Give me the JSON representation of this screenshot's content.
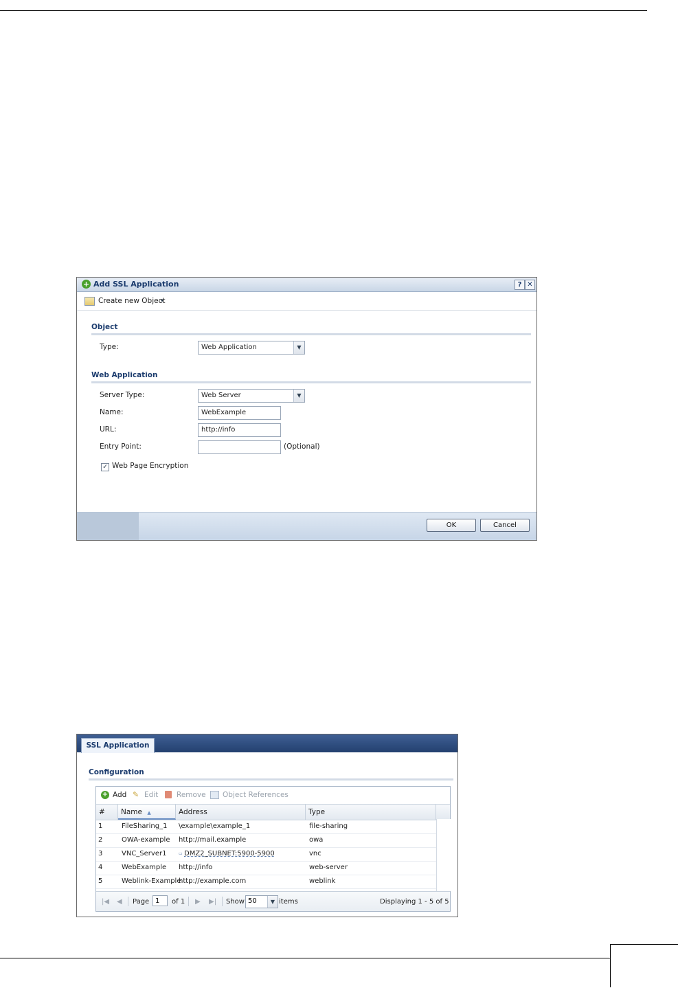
{
  "dialog": {
    "title": "Add SSL Application",
    "help_icon": "?",
    "close_icon": "✕",
    "toolbar": {
      "create_label": "Create new Object",
      "caret": "▾",
      "icon": "object-icon"
    },
    "section_object": "Object",
    "type_label": "Type:",
    "type_value": "Web Application",
    "section_webapp": "Web Application",
    "server_type_label": "Server Type:",
    "server_type_value": "Web Server",
    "name_label": "Name:",
    "name_value": "WebExample",
    "url_label": "URL:",
    "url_value": "http://info",
    "entry_point_label": "Entry Point:",
    "entry_point_value": "",
    "optional_label": "(Optional)",
    "encryption_label": "Web Page Encryption",
    "encryption_checked": "✓",
    "ok_label": "OK",
    "cancel_label": "Cancel"
  },
  "panel": {
    "tab": "SSL Application",
    "section": "Configuration",
    "toolbar": {
      "add": "Add",
      "edit": "Edit",
      "remove": "Remove",
      "refs": "Object References"
    },
    "columns": [
      "#",
      "Name",
      "Address",
      "Type"
    ],
    "sort_arrow": "▲",
    "rows": [
      {
        "num": "1",
        "name": "FileSharing_1",
        "address": "\\example\\example_1",
        "type": "file-sharing"
      },
      {
        "num": "2",
        "name": "OWA-example",
        "address": "http://mail.example",
        "type": "owa"
      },
      {
        "num": "3",
        "name": "VNC_Server1",
        "address": "DMZ2_SUBNET:5900-5900",
        "type": "vnc"
      },
      {
        "num": "4",
        "name": "WebExample",
        "address": "http://info",
        "type": "web-server"
      },
      {
        "num": "5",
        "name": "Weblink-Example",
        "address": "http://example.com",
        "type": "weblink"
      }
    ],
    "pager": {
      "page_label": "Page",
      "page_value": "1",
      "of_label": "of 1",
      "show_label": "Show",
      "show_value": "50",
      "items_label": "items",
      "displaying": "Displaying 1 - 5 of 5"
    }
  },
  "colors": {
    "accent": "#1c3c6e",
    "header_bar": "#2b4a7c",
    "add_green": "#4aa02c"
  }
}
